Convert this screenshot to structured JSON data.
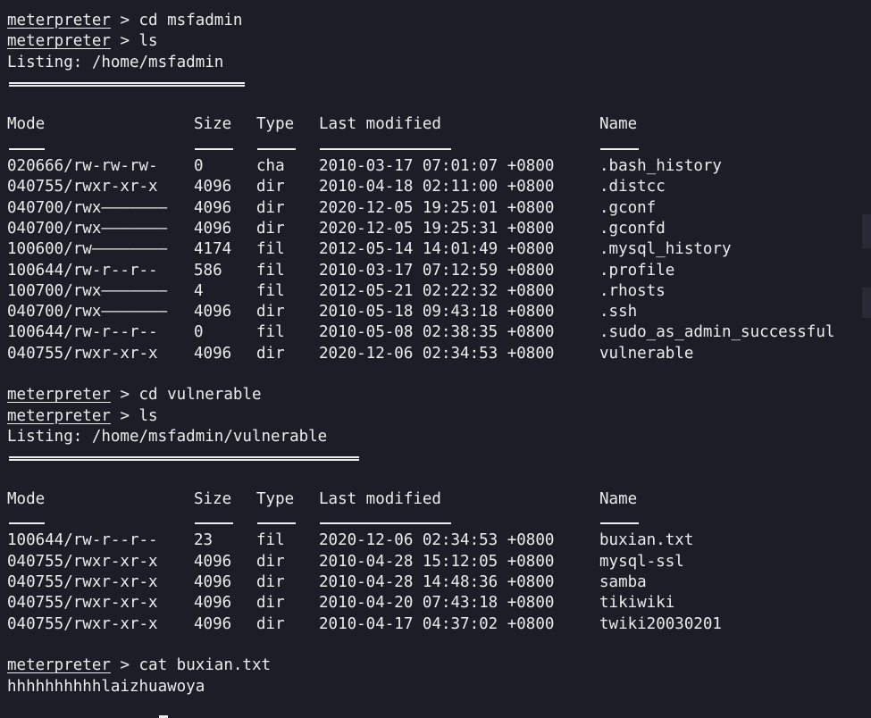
{
  "prompt": "meterpreter",
  "commands": {
    "cd_msfadmin": " > cd msfadmin",
    "ls_1": " > ls",
    "cd_vulnerable": " > cd vulnerable",
    "ls_2": " > ls",
    "cat": " > cat buxian.txt"
  },
  "listing1": {
    "title": "Listing: /home/msfadmin",
    "headers": {
      "mode": "Mode",
      "size": "Size",
      "type": "Type",
      "modified": "Last modified",
      "name": "Name"
    },
    "rows": [
      {
        "mode": "020666/rw-rw-rw-",
        "size": "0",
        "type": "cha",
        "modified": "2010-03-17 07:01:07 +0800",
        "name": ".bash_history"
      },
      {
        "mode": "040755/rwxr-xr-x",
        "size": "4096",
        "type": "dir",
        "modified": "2010-04-18 02:11:00 +0800",
        "name": ".distcc"
      },
      {
        "mode": "040700/rwx———————",
        "size": "4096",
        "type": "dir",
        "modified": "2020-12-05 19:25:01 +0800",
        "name": ".gconf"
      },
      {
        "mode": "040700/rwx———————",
        "size": "4096",
        "type": "dir",
        "modified": "2020-12-05 19:25:31 +0800",
        "name": ".gconfd"
      },
      {
        "mode": "100600/rw————————",
        "size": "4174",
        "type": "fil",
        "modified": "2012-05-14 14:01:49 +0800",
        "name": ".mysql_history"
      },
      {
        "mode": "100644/rw-r--r--",
        "size": "586",
        "type": "fil",
        "modified": "2010-03-17 07:12:59 +0800",
        "name": ".profile"
      },
      {
        "mode": "100700/rwx———————",
        "size": "4",
        "type": "fil",
        "modified": "2012-05-21 02:22:32 +0800",
        "name": ".rhosts"
      },
      {
        "mode": "040700/rwx———————",
        "size": "4096",
        "type": "dir",
        "modified": "2010-05-18 09:43:18 +0800",
        "name": ".ssh"
      },
      {
        "mode": "100644/rw-r--r--",
        "size": "0",
        "type": "fil",
        "modified": "2010-05-08 02:38:35 +0800",
        "name": ".sudo_as_admin_successful"
      },
      {
        "mode": "040755/rwxr-xr-x",
        "size": "4096",
        "type": "dir",
        "modified": "2020-12-06 02:34:53 +0800",
        "name": "vulnerable"
      }
    ]
  },
  "listing2": {
    "title": "Listing: /home/msfadmin/vulnerable",
    "headers": {
      "mode": "Mode",
      "size": "Size",
      "type": "Type",
      "modified": "Last modified",
      "name": "Name"
    },
    "rows": [
      {
        "mode": "100644/rw-r--r--",
        "size": "23",
        "type": "fil",
        "modified": "2020-12-06 02:34:53 +0800",
        "name": "buxian.txt"
      },
      {
        "mode": "040755/rwxr-xr-x",
        "size": "4096",
        "type": "dir",
        "modified": "2010-04-28 15:12:05 +0800",
        "name": "mysql-ssl"
      },
      {
        "mode": "040755/rwxr-xr-x",
        "size": "4096",
        "type": "dir",
        "modified": "2010-04-28 14:48:36 +0800",
        "name": "samba"
      },
      {
        "mode": "040755/rwxr-xr-x",
        "size": "4096",
        "type": "dir",
        "modified": "2010-04-20 07:43:18 +0800",
        "name": "tikiwiki"
      },
      {
        "mode": "040755/rwxr-xr-x",
        "size": "4096",
        "type": "dir",
        "modified": "2010-04-17 04:37:02 +0800",
        "name": "twiki20030201"
      }
    ]
  },
  "cat_output": "hhhhhhhhhhlaizhuawoya"
}
